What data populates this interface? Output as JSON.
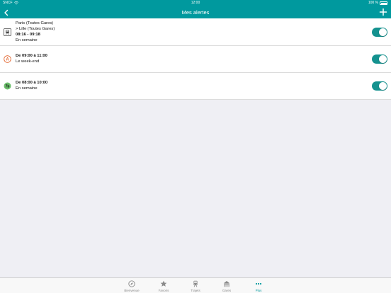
{
  "status": {
    "carrier": "SNCF",
    "time": "12:00",
    "battery": "100 %"
  },
  "nav": {
    "title": "Mes alertes"
  },
  "alerts": [
    {
      "icon": "train-icon",
      "route_from": "Paris (Toutes Gares)",
      "route_to": " > Lille (Toutes Gares)",
      "time": "08:16 - 09:18",
      "days": "En semaine",
      "enabled": true
    },
    {
      "icon": "rer-a-icon",
      "icon_text": "A",
      "time": "De 09:00 à 11:00",
      "days": "Le week-end",
      "enabled": true
    },
    {
      "icon": "line-7bis-icon",
      "icon_text": "7b",
      "time": "De 08:00 à 10:00",
      "days": "En semaine",
      "enabled": true
    }
  ],
  "tabs": [
    {
      "label": "Bienvenue",
      "icon": "compass-icon",
      "active": false
    },
    {
      "label": "Favoris",
      "icon": "star-icon",
      "active": false
    },
    {
      "label": "Trajets",
      "icon": "train-icon",
      "active": false
    },
    {
      "label": "Gares",
      "icon": "station-icon",
      "active": false
    },
    {
      "label": "Plus",
      "icon": "more-icon",
      "active": true
    }
  ],
  "colors": {
    "accent": "#00999e",
    "toggle_on": "#14928f",
    "rer_a": "#e2622a",
    "line_7bis": "#6cbf6c"
  }
}
